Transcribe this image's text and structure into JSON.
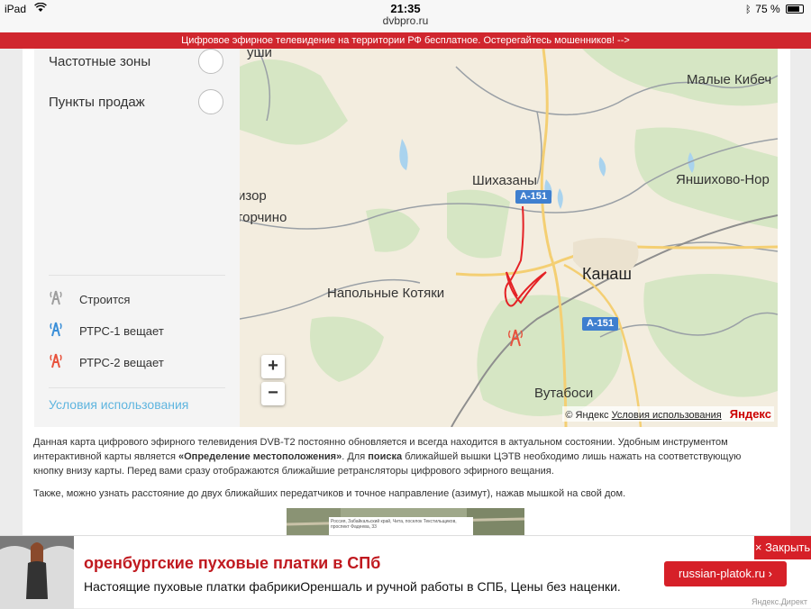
{
  "status_bar": {
    "device": "iPad",
    "time": "21:35",
    "battery": "75 %"
  },
  "browser": {
    "url": "dvbpro.ru"
  },
  "notice": {
    "text": "Цифровое эфирное телевидение на территории РФ бесплатное. Остерегайтесь мошенников! -->"
  },
  "sidebar": {
    "options": [
      {
        "label": "Частотные зоны"
      },
      {
        "label": "Пункты продаж"
      }
    ],
    "legend": [
      {
        "label": "Строится",
        "color": "#9e9e9e"
      },
      {
        "label": "РТРС-1 вещает",
        "color": "#3b8fd8"
      },
      {
        "label": "РТРС-2 вещает",
        "color": "#e8533d"
      }
    ],
    "terms_link": "Условия использования"
  },
  "map": {
    "places": {
      "top_left": "уши",
      "malye_kibechi": "Малые Кибеч",
      "shikhazany": "Шихазаны",
      "yanshikhovo": "Яншихово-Нор",
      "izor": "изор",
      "gorchino": "горчино",
      "napolnye": "Напольные Котяки",
      "kanash": "Канаш",
      "vutabosi": "Вутабоси"
    },
    "road_labels": [
      "А-151",
      "А-151"
    ],
    "zoom_in": "+",
    "zoom_out": "−",
    "copyright": "© Яндекс",
    "terms": "Условия использования",
    "brand": "Яндекс",
    "colors": {
      "water": "#a9d3ee",
      "forest": "#d6e6c4",
      "road_major": "#f4cf73",
      "road_minor": "#9aa0a6",
      "marker": "#e42226",
      "route_badge": "#3f7fcf"
    }
  },
  "content": {
    "para1_a": "Данная карта цифрового эфирного телевидения DVB-T2 постоянно обновляется и всегда находится в актуальном состоянии. Удобным инструментом интерактивной карты является ",
    "para1_b": "«Определение местоположения»",
    "para1_c": ". Для ",
    "para1_d": "поиска",
    "para1_e": " ближайшей вышки ЦЭТВ необходимо лишь нажать на соответствующую кнопку внизу карты. Перед вами сразу отображаются ближайшие ретрансляторы цифрового эфирного вещания.",
    "para2": "Также, можно узнать расстояние до двух ближайших передатчиков и точное направление (азимут), нажав мышкой на свой дом.",
    "thumb_caption": "Россия, Забайкальский край, Чита, поселок Текстильщиков, проспект Фадеева, 33"
  },
  "ad": {
    "title": "оренбургские пуховые платки в СПб",
    "text": "Настоящие пуховые платки фабрикиОреншаль и ручной работы в СПБ, Цены без наценки.",
    "button": "russian-platok.ru  ›",
    "close": "× Закрыть",
    "source": "Яндекс.Директ"
  }
}
